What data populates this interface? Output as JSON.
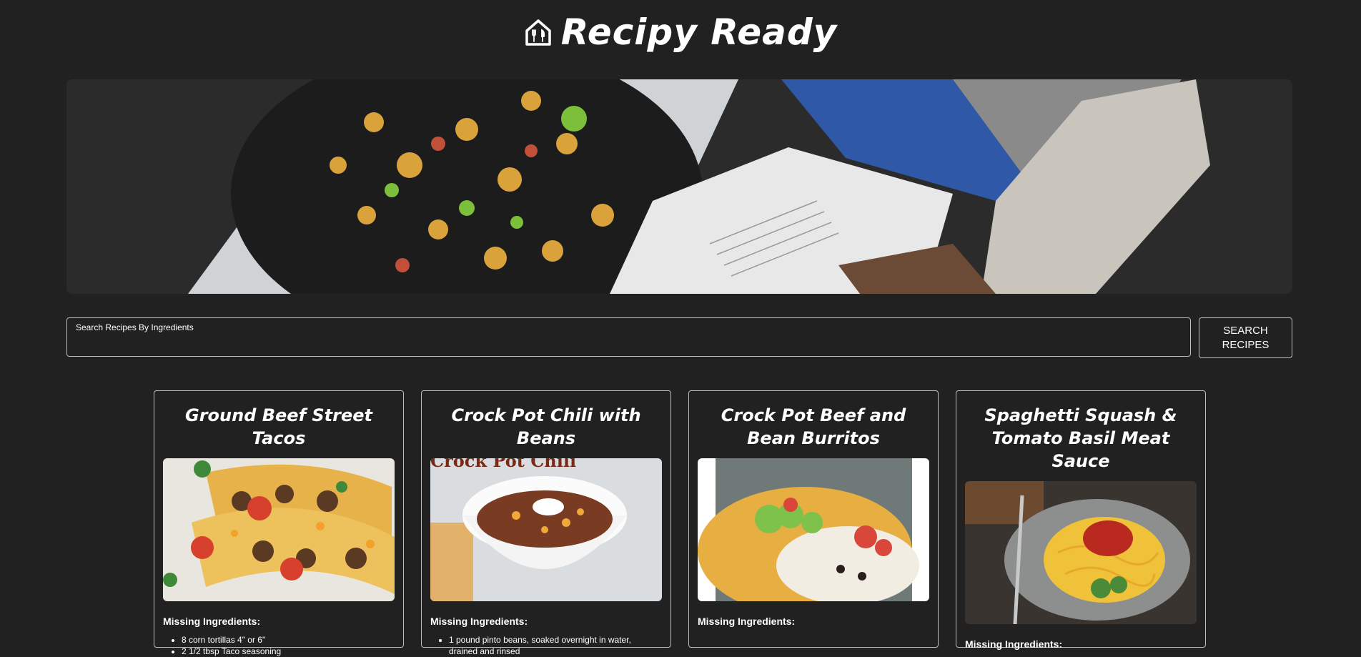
{
  "header": {
    "title": "Recipy Ready",
    "icon": "restaurant-home-icon"
  },
  "hero": {
    "image": "cooking-book-and-pan-photo"
  },
  "search": {
    "label": "Search Recipes By Ingredients",
    "value": "",
    "button_label": "SEARCH RECIPES"
  },
  "recipes": [
    {
      "title": "Ground Beef Street Tacos",
      "image": "tacos-photo",
      "missing_label": "Missing Ingredients:",
      "missing": [
        "8 corn tortillas 4\" or 6\"",
        "2 1/2 tbsp Taco seasoning"
      ]
    },
    {
      "title": "Crock Pot Chili with Beans",
      "image": "chili-bowl-photo",
      "image_text": "Crock Pot Chili",
      "missing_label": "Missing Ingredients:",
      "missing": [
        "1 pound pinto beans, soaked overnight in water, drained and rinsed"
      ]
    },
    {
      "title": "Crock Pot Beef and Bean Burritos",
      "image": "burrito-plate-photo",
      "missing_label": "Missing Ingredients:",
      "missing": []
    },
    {
      "title": "Spaghetti Squash & Tomato Basil Meat Sauce",
      "image": "spaghetti-squash-photo",
      "missing_label": "Missing Ingredients:",
      "missing": []
    }
  ],
  "colors": {
    "background": "#212121",
    "border": "#bdbdbd",
    "text": "#ffffff"
  }
}
